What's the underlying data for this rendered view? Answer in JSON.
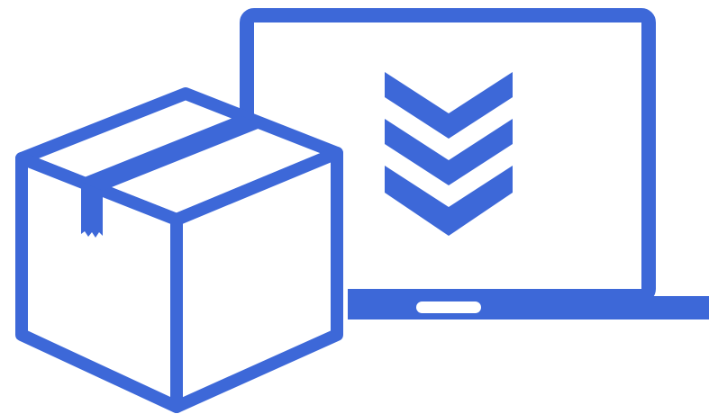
{
  "illustration": {
    "accent_color": "#3D68D8",
    "background_color": "#FFFFFF",
    "icons": [
      "package-box-icon",
      "laptop-icon",
      "triple-chevron-down-icon",
      "tape-strip-icon"
    ]
  }
}
